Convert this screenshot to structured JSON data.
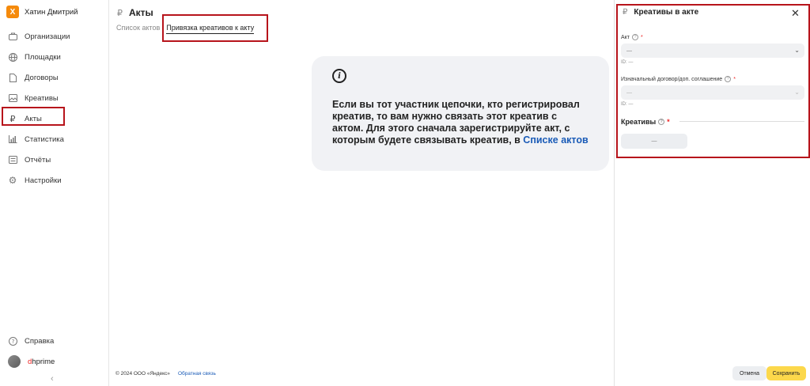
{
  "user": {
    "logo_letter": "X",
    "name": "Хатин Дмитрий"
  },
  "sidebar": {
    "items": [
      {
        "label": "Организации",
        "icon": "briefcase-icon"
      },
      {
        "label": "Площадки",
        "icon": "globe-icon"
      },
      {
        "label": "Договоры",
        "icon": "document-icon"
      },
      {
        "label": "Креативы",
        "icon": "image-icon"
      },
      {
        "label": "Акты",
        "icon": "ruble-icon"
      },
      {
        "label": "Статистика",
        "icon": "bar-chart-icon"
      },
      {
        "label": "Отчёты",
        "icon": "report-icon"
      },
      {
        "label": "Настройки",
        "icon": "gear-icon"
      }
    ],
    "help_label": "Справка",
    "account_prefix": "d",
    "account_rest": "hprime",
    "collapse_glyph": "‹"
  },
  "page": {
    "title": "Акты",
    "currency_glyph": "₽",
    "tabs": [
      "Список актов",
      "Привязка креативов к акту"
    ]
  },
  "info": {
    "glyph": "i",
    "text": "Если вы тот участник цепочки, кто регистрировал креатив, то вам нужно связать этот креатив с актом. Для этого сначала зарегистрируйте акт, с которым будете связывать креатив, в ",
    "link": "Списке актов"
  },
  "footer": {
    "copyright": "© 2024 ООО «Яндекс»",
    "feedback": "Обратная связь"
  },
  "drawer": {
    "title": "Креативы в акте",
    "close_glyph": "✕",
    "act_label": "Акт",
    "act_value": "—",
    "act_id": "ID: —",
    "contract_label": "Изначальный договор/доп. соглашение",
    "contract_value": "—",
    "contract_id": "ID: —",
    "creatives_label": "Креативы",
    "creatives_value": "—",
    "required_mark": "*",
    "help_glyph": "?",
    "chevron_glyph": "⌄",
    "cancel_label": "Отмена",
    "save_label": "Сохранить"
  },
  "colors": {
    "accent": "#fcd84b",
    "link": "#1a5bb7",
    "highlight": "#b7141b",
    "logo": "#f58a0b"
  }
}
